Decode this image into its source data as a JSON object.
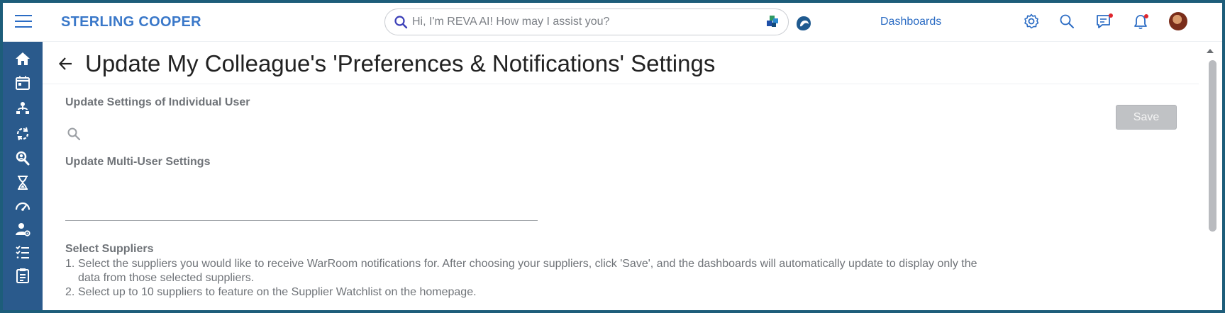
{
  "brand": "STERLING COOPER",
  "search": {
    "placeholder": "Hi, I'm REVA AI! How may I assist you?"
  },
  "nav": {
    "dashboards": "Dashboards"
  },
  "notifications": {
    "messages_dot_color": "#e0262d",
    "bell_dot_color": "#e0262d"
  },
  "sidebar": {
    "items": [
      {
        "icon": "home-icon"
      },
      {
        "icon": "calendar-icon"
      },
      {
        "icon": "hierarchy-icon"
      },
      {
        "icon": "refresh-cycle-icon"
      },
      {
        "icon": "search-user-icon"
      },
      {
        "icon": "hourglass-icon"
      },
      {
        "icon": "gauge-icon"
      },
      {
        "icon": "user-settings-icon"
      },
      {
        "icon": "checklist-icon"
      },
      {
        "icon": "clipboard-icon"
      }
    ]
  },
  "page": {
    "title": "Update My Colleague's 'Preferences & Notifications' Settings",
    "individual_heading": "Update Settings of Individual User",
    "multi_heading": "Update Multi-User Settings",
    "save_label": "Save",
    "select_suppliers": {
      "heading": "Select Suppliers",
      "items": [
        "Select the suppliers you would like to receive WarRoom notifications for. After choosing your suppliers, click 'Save', and the dashboards will automatically update to display only the data from those selected suppliers.",
        "Select up to 10 suppliers to feature on the Supplier Watchlist on the homepage."
      ]
    }
  },
  "colors": {
    "brand": "#3a78c9",
    "sidebar_bg": "#2a5a8c",
    "frame_border": "#1d5d7a",
    "save_disabled": "#c0c2c5"
  }
}
